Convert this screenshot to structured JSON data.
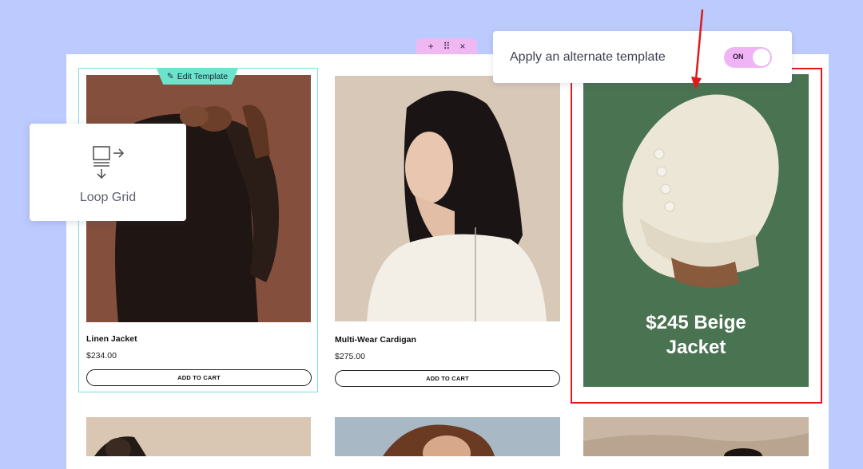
{
  "editor": {
    "handle": {
      "add_icon": "+",
      "drag_icon": "⠿",
      "close_icon": "×"
    },
    "edit_template_label": "Edit Template"
  },
  "products": [
    {
      "title": "Linen Jacket",
      "price": "$234.00",
      "button": "ADD TO CART"
    },
    {
      "title": "Multi-Wear Cardigan",
      "price": "$275.00",
      "button": "ADD TO CART"
    }
  ],
  "promo": {
    "line1": "$245 Beige",
    "line2": "Jacket",
    "background": "#4a7352"
  },
  "popup": {
    "label": "Apply an alternate template",
    "toggle_text": "ON",
    "toggle_color": "#f0b3f5"
  },
  "widget": {
    "label": "Loop Grid",
    "icon": "loop-grid-icon"
  },
  "colors": {
    "background": "#bccafd",
    "highlight": "#e01a1a",
    "selection": "#76e4d2"
  }
}
